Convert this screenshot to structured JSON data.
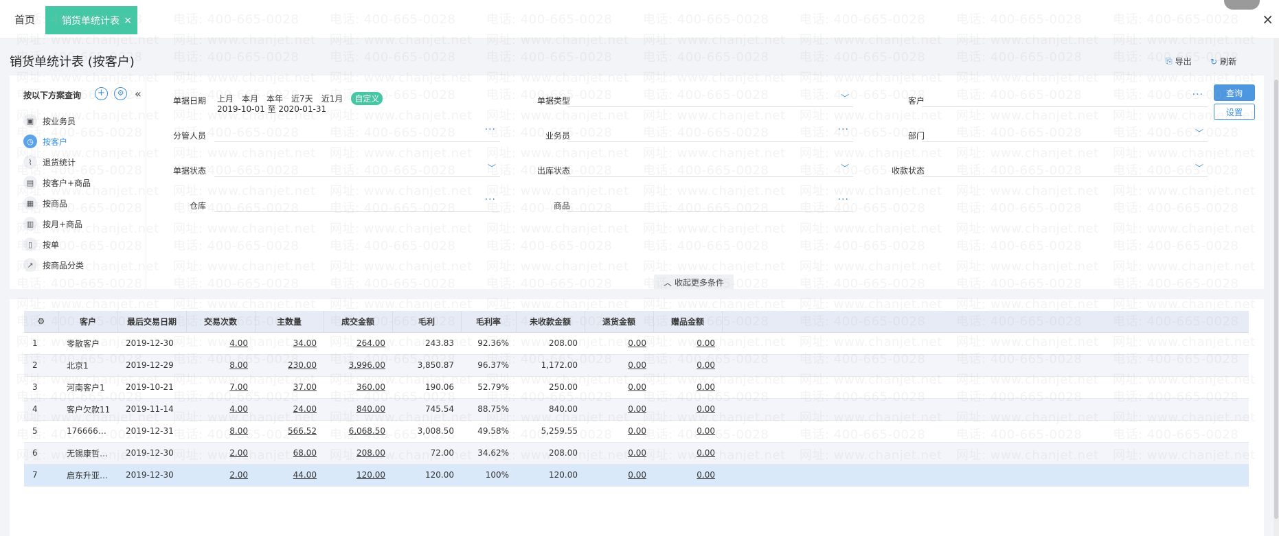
{
  "tabs": {
    "home": "首页",
    "active": "销货单统计表",
    "close": "×"
  },
  "window": {
    "close": "×"
  },
  "page": {
    "title": "销货单统计表 (按客户)",
    "export_label": "导出",
    "refresh_label": "刷新"
  },
  "schemes": {
    "title": "按以下方案查询",
    "add_icon": "+",
    "settings_icon": "⚙",
    "collapse_icon": "«",
    "items": [
      {
        "label": "按业务员",
        "icon": "cube-icon"
      },
      {
        "label": "按客户",
        "icon": "clock-icon",
        "active": true
      },
      {
        "label": "退货统计",
        "icon": "chart-line-icon"
      },
      {
        "label": "按客户+商品",
        "icon": "table-icon"
      },
      {
        "label": "按商品",
        "icon": "grid-icon"
      },
      {
        "label": "按月+商品",
        "icon": "bar-chart-icon"
      },
      {
        "label": "按单",
        "icon": "document-icon"
      },
      {
        "label": "按商品分类",
        "icon": "trend-icon"
      }
    ]
  },
  "filters": {
    "date_label": "单据日期",
    "date_options": [
      "上月",
      "本月",
      "本年",
      "近7天",
      "近1月"
    ],
    "date_custom": "自定义",
    "date_range": "2019-10-01 至 2020-01-31",
    "doc_type_label": "单据类型",
    "customer_label": "客户",
    "manager_label": "分管人员",
    "salesman_label": "业务员",
    "department_label": "部门",
    "doc_status_label": "单据状态",
    "outbound_status_label": "出库状态",
    "payment_status_label": "收款状态",
    "warehouse_label": "仓库",
    "product_label": "商品",
    "query_button": "查询",
    "settings_button": "设置",
    "collapse_more": "收起更多条件"
  },
  "table": {
    "headers": [
      "客户",
      "最后交易日期",
      "交易次数",
      "主数量",
      "成交金额",
      "毛利",
      "毛利率",
      "未收款金额",
      "退货金额",
      "赠品金额"
    ],
    "rows": [
      {
        "no": "1",
        "customer": "零散客户",
        "date": "2019-12-30",
        "count": "4.00",
        "qty": "34.00",
        "amount": "264.00",
        "profit": "243.83",
        "rate": "92.36%",
        "unpaid": "208.00",
        "returned": "0.00",
        "gift": "0.00"
      },
      {
        "no": "2",
        "customer": "北京1",
        "date": "2019-12-29",
        "count": "8.00",
        "qty": "230.00",
        "amount": "3,996.00",
        "profit": "3,850.87",
        "rate": "96.37%",
        "unpaid": "1,172.00",
        "returned": "0.00",
        "gift": "0.00"
      },
      {
        "no": "3",
        "customer": "河南客户1",
        "date": "2019-10-21",
        "count": "7.00",
        "qty": "37.00",
        "amount": "360.00",
        "profit": "190.06",
        "rate": "52.79%",
        "unpaid": "250.00",
        "returned": "0.00",
        "gift": "0.00"
      },
      {
        "no": "4",
        "customer": "客户欠款11",
        "date": "2019-11-14",
        "count": "4.00",
        "qty": "24.00",
        "amount": "840.00",
        "profit": "745.54",
        "rate": "88.75%",
        "unpaid": "840.00",
        "returned": "0.00",
        "gift": "0.00"
      },
      {
        "no": "5",
        "customer": "1766666…",
        "date": "2019-12-31",
        "count": "8.00",
        "qty": "566.52",
        "amount": "6,068.50",
        "profit": "3,008.50",
        "rate": "49.58%",
        "unpaid": "5,259.55",
        "returned": "0.00",
        "gift": "0.00"
      },
      {
        "no": "6",
        "customer": "无锡康哲…",
        "date": "2019-12-30",
        "count": "2.00",
        "qty": "68.00",
        "amount": "208.00",
        "profit": "72.00",
        "rate": "34.62%",
        "unpaid": "208.00",
        "returned": "0.00",
        "gift": "0.00"
      },
      {
        "no": "7",
        "customer": "启东升亚…",
        "date": "2019-12-30",
        "count": "2.00",
        "qty": "44.00",
        "amount": "120.00",
        "profit": "120.00",
        "rate": "100%",
        "unpaid": "120.00",
        "returned": "0.00",
        "gift": "0.00"
      }
    ]
  },
  "watermark": {
    "phone": "电话: 400-665-0028",
    "site": "网址: www.chanjet.net"
  }
}
